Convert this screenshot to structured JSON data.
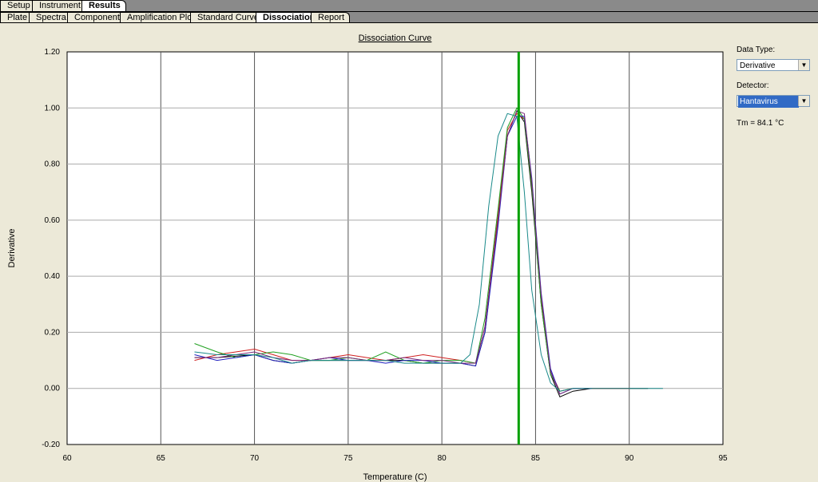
{
  "tabs_top": [
    "Setup",
    "Instrument",
    "Results"
  ],
  "tabs_top_active": "Results",
  "tabs_results": [
    "Plate",
    "Spectra",
    "Component",
    "Amplification Plot",
    "Standard Curve",
    "Dissociation",
    "Report"
  ],
  "tabs_results_active": "Dissociation",
  "side_panel": {
    "data_type_label": "Data Type:",
    "data_type_value": "Derivative",
    "detector_label": "Detector:",
    "detector_value": "Hantavirus",
    "tm_text": "Tm = 84.1 °C"
  },
  "colors": {
    "tm_line": "#00a000",
    "grid": "#808080"
  },
  "chart_data": {
    "type": "line",
    "title": "Dissociation Curve",
    "xlabel": "Temperature (C)",
    "ylabel": "Derivative",
    "xlim": [
      60,
      95
    ],
    "ylim": [
      -0.2,
      1.2
    ],
    "xticks": [
      60,
      65,
      70,
      75,
      80,
      85,
      90,
      95
    ],
    "yticks": [
      "-0.20",
      "0.00",
      "0.20",
      "0.40",
      "0.60",
      "0.80",
      "1.00",
      "1.20"
    ],
    "grid": true,
    "tm_marker": 84.1,
    "series": [
      {
        "color": "#000000",
        "x": [
          66.8,
          68,
          70,
          71,
          72,
          73,
          74,
          75,
          76,
          77,
          78,
          79,
          80,
          81,
          81.8,
          82.3,
          83,
          83.5,
          84,
          84.4,
          84.8,
          85.3,
          85.8,
          86.3,
          87,
          88,
          90,
          91
        ],
        "y": [
          0.11,
          0.11,
          0.12,
          0.1,
          0.09,
          0.1,
          0.1,
          0.1,
          0.1,
          0.1,
          0.1,
          0.09,
          0.09,
          0.09,
          0.08,
          0.2,
          0.6,
          0.9,
          0.99,
          0.95,
          0.7,
          0.3,
          0.05,
          -0.03,
          -0.01,
          0,
          0,
          0
        ]
      },
      {
        "color": "#d02020",
        "x": [
          66.8,
          68,
          70,
          71,
          72,
          73,
          74,
          75,
          76,
          77,
          78,
          79,
          80,
          81,
          81.8,
          82.3,
          83,
          83.5,
          84,
          84.4,
          84.8,
          85.3,
          85.8,
          86.3,
          87,
          88,
          90
        ],
        "y": [
          0.1,
          0.12,
          0.14,
          0.12,
          0.1,
          0.1,
          0.11,
          0.12,
          0.11,
          0.1,
          0.11,
          0.12,
          0.11,
          0.1,
          0.09,
          0.22,
          0.62,
          0.92,
          0.98,
          0.96,
          0.72,
          0.32,
          0.06,
          -0.01,
          0,
          0,
          0
        ]
      },
      {
        "color": "#20a020",
        "x": [
          66.8,
          68,
          69,
          70,
          71,
          72,
          73,
          74,
          75,
          76,
          77,
          78,
          79,
          80,
          81,
          81.8,
          82.3,
          83,
          83.5,
          84,
          84.4,
          84.8,
          85.3,
          85.8,
          86.3,
          87,
          88
        ],
        "y": [
          0.16,
          0.13,
          0.11,
          0.12,
          0.13,
          0.12,
          0.1,
          0.1,
          0.11,
          0.1,
          0.13,
          0.1,
          0.09,
          0.1,
          0.1,
          0.09,
          0.25,
          0.64,
          0.93,
          1.0,
          0.96,
          0.72,
          0.3,
          0.05,
          -0.01,
          0,
          0
        ]
      },
      {
        "color": "#2020c0",
        "x": [
          66.8,
          68,
          69,
          70,
          71,
          72,
          73,
          74,
          75,
          76,
          77,
          78,
          79,
          80,
          81,
          81.8,
          82.3,
          83,
          83.5,
          84,
          84.4,
          84.8,
          85.3,
          85.8,
          86.3,
          87,
          88
        ],
        "y": [
          0.12,
          0.1,
          0.11,
          0.12,
          0.1,
          0.09,
          0.1,
          0.11,
          0.1,
          0.1,
          0.09,
          0.1,
          0.1,
          0.09,
          0.09,
          0.08,
          0.2,
          0.58,
          0.9,
          0.97,
          0.97,
          0.75,
          0.34,
          0.07,
          -0.02,
          0,
          0
        ]
      },
      {
        "color": "#7a2a7a",
        "x": [
          66.8,
          68,
          69,
          70,
          71,
          72,
          73,
          74,
          75,
          76,
          77,
          78,
          79,
          80,
          81,
          81.8,
          82.3,
          83,
          83.5,
          84,
          84.4,
          84.8,
          85.3,
          85.8,
          86.3,
          87,
          88
        ],
        "y": [
          0.11,
          0.11,
          0.12,
          0.13,
          0.11,
          0.1,
          0.1,
          0.11,
          0.11,
          0.1,
          0.1,
          0.11,
          0.1,
          0.1,
          0.09,
          0.09,
          0.22,
          0.6,
          0.9,
          0.99,
          0.98,
          0.74,
          0.33,
          0.06,
          -0.02,
          0,
          0
        ]
      },
      {
        "color": "#1a8a8a",
        "x": [
          66.8,
          68,
          70,
          71,
          72,
          73,
          74,
          75,
          76,
          77,
          78,
          79,
          80,
          81,
          81.5,
          82,
          82.5,
          83,
          83.5,
          84,
          84.4,
          84.8,
          85.3,
          85.8,
          86.3,
          87,
          88,
          90,
          91.8
        ],
        "y": [
          0.13,
          0.12,
          0.12,
          0.11,
          0.09,
          0.1,
          0.1,
          0.1,
          0.1,
          0.1,
          0.09,
          0.09,
          0.09,
          0.09,
          0.12,
          0.3,
          0.65,
          0.9,
          0.98,
          0.97,
          0.7,
          0.35,
          0.12,
          0.02,
          -0.01,
          0,
          0,
          0,
          0
        ]
      }
    ]
  }
}
